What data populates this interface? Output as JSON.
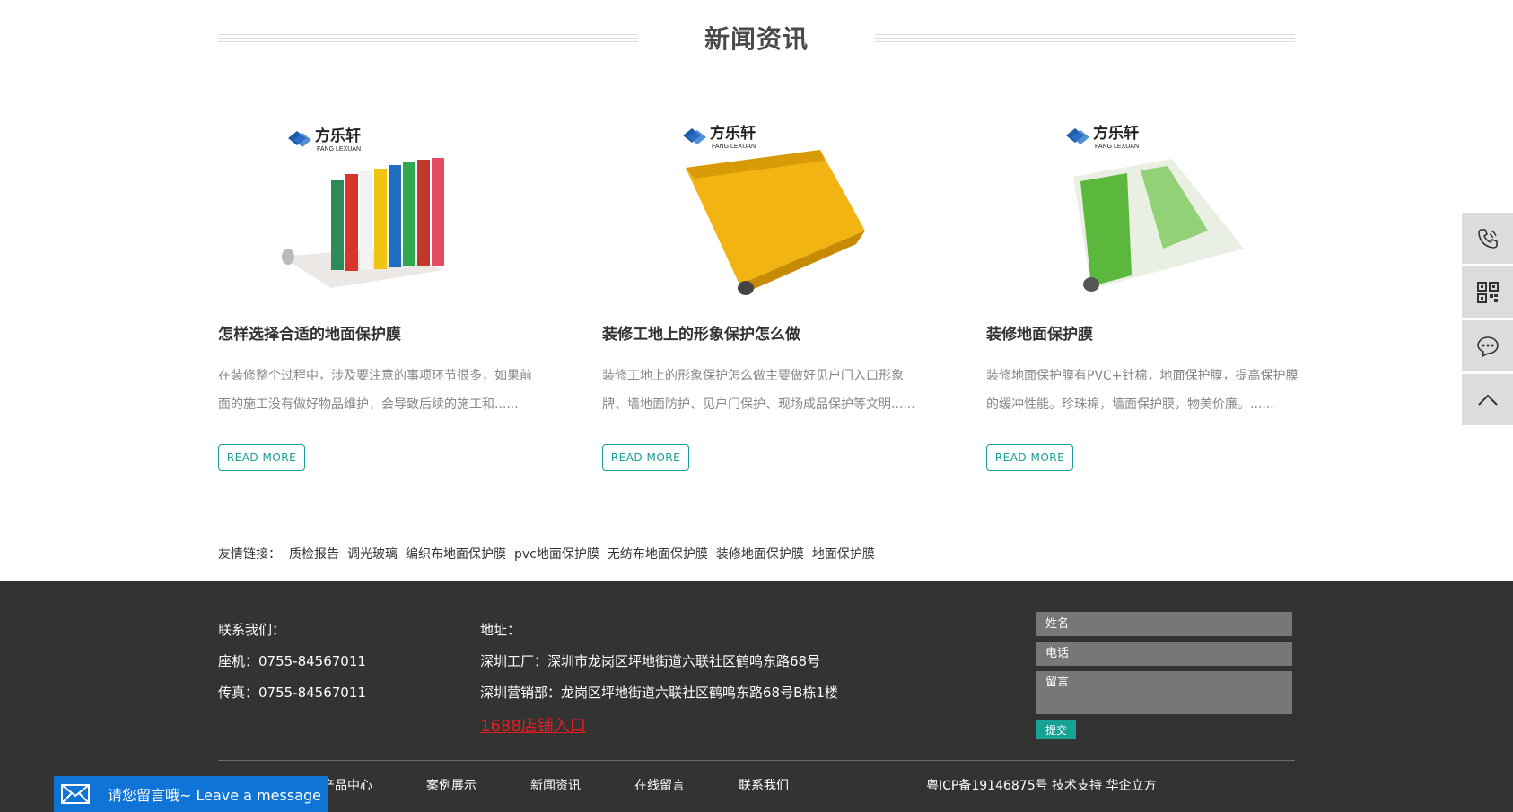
{
  "section": {
    "title": "新闻资讯"
  },
  "news": [
    {
      "title": "怎样选择合适的地面保护膜",
      "desc": "在装修整个过程中，涉及要注意的事项环节很多，如果前面的施工没有做好物品维护，会导致后续的施工和......",
      "read_more": "READ MORE",
      "brand": "方乐轩",
      "brand_en": "FANG LEXUAN"
    },
    {
      "title": "装修工地上的形象保护怎么做",
      "desc": "装修工地上的形象保护怎么做主要做好见户门入口形象牌、墙地面防护、见户门保护、现场成品保护等文明......",
      "read_more": "READ MORE",
      "brand": "方乐轩",
      "brand_en": "FANG LEXUAN"
    },
    {
      "title": "装修地面保护膜",
      "desc": "装修地面保护膜有PVC+针棉，地面保护膜，提高保护膜的缓冲性能。珍珠棉，墙面保护膜，物美价廉。......",
      "read_more": "READ MORE",
      "brand": "方乐轩",
      "brand_en": "FANG LEXUAN"
    }
  ],
  "friend_links": {
    "label": "友情链接：",
    "items": [
      "质检报告",
      "调光玻璃",
      "编织布地面保护膜",
      "pvc地面保护膜",
      "无纺布地面保护膜",
      "装修地面保护膜",
      "地面保护膜"
    ]
  },
  "footer": {
    "contact": {
      "heading": "联系我们：",
      "phone": "座机：0755-84567011",
      "fax": "传真：0755-84567011"
    },
    "address": {
      "heading": "地址：",
      "factory": "深圳工厂：深圳市龙岗区坪地街道六联社区鹤鸣东路68号",
      "sales": "深圳营销部：龙岗区坪地街道六联社区鹤鸣东路68号B栋1楼",
      "shop_link": "1688店铺入口"
    },
    "form": {
      "name": "姓名",
      "phone": "电话",
      "message": "留言",
      "submit": "提交"
    },
    "nav": [
      "产品中心",
      "案例展示",
      "新闻资讯",
      "在线留言",
      "联系我们"
    ],
    "icp": "粤ICP备19146875号 技术支持 华企立方"
  },
  "message_bar": {
    "label": "请您留言哦~ Leave a message"
  },
  "colors": {
    "accent": "#1a9e94",
    "footer_bg": "#333333",
    "link_red": "#e41e1e",
    "message_blue": "#0f74d6"
  }
}
